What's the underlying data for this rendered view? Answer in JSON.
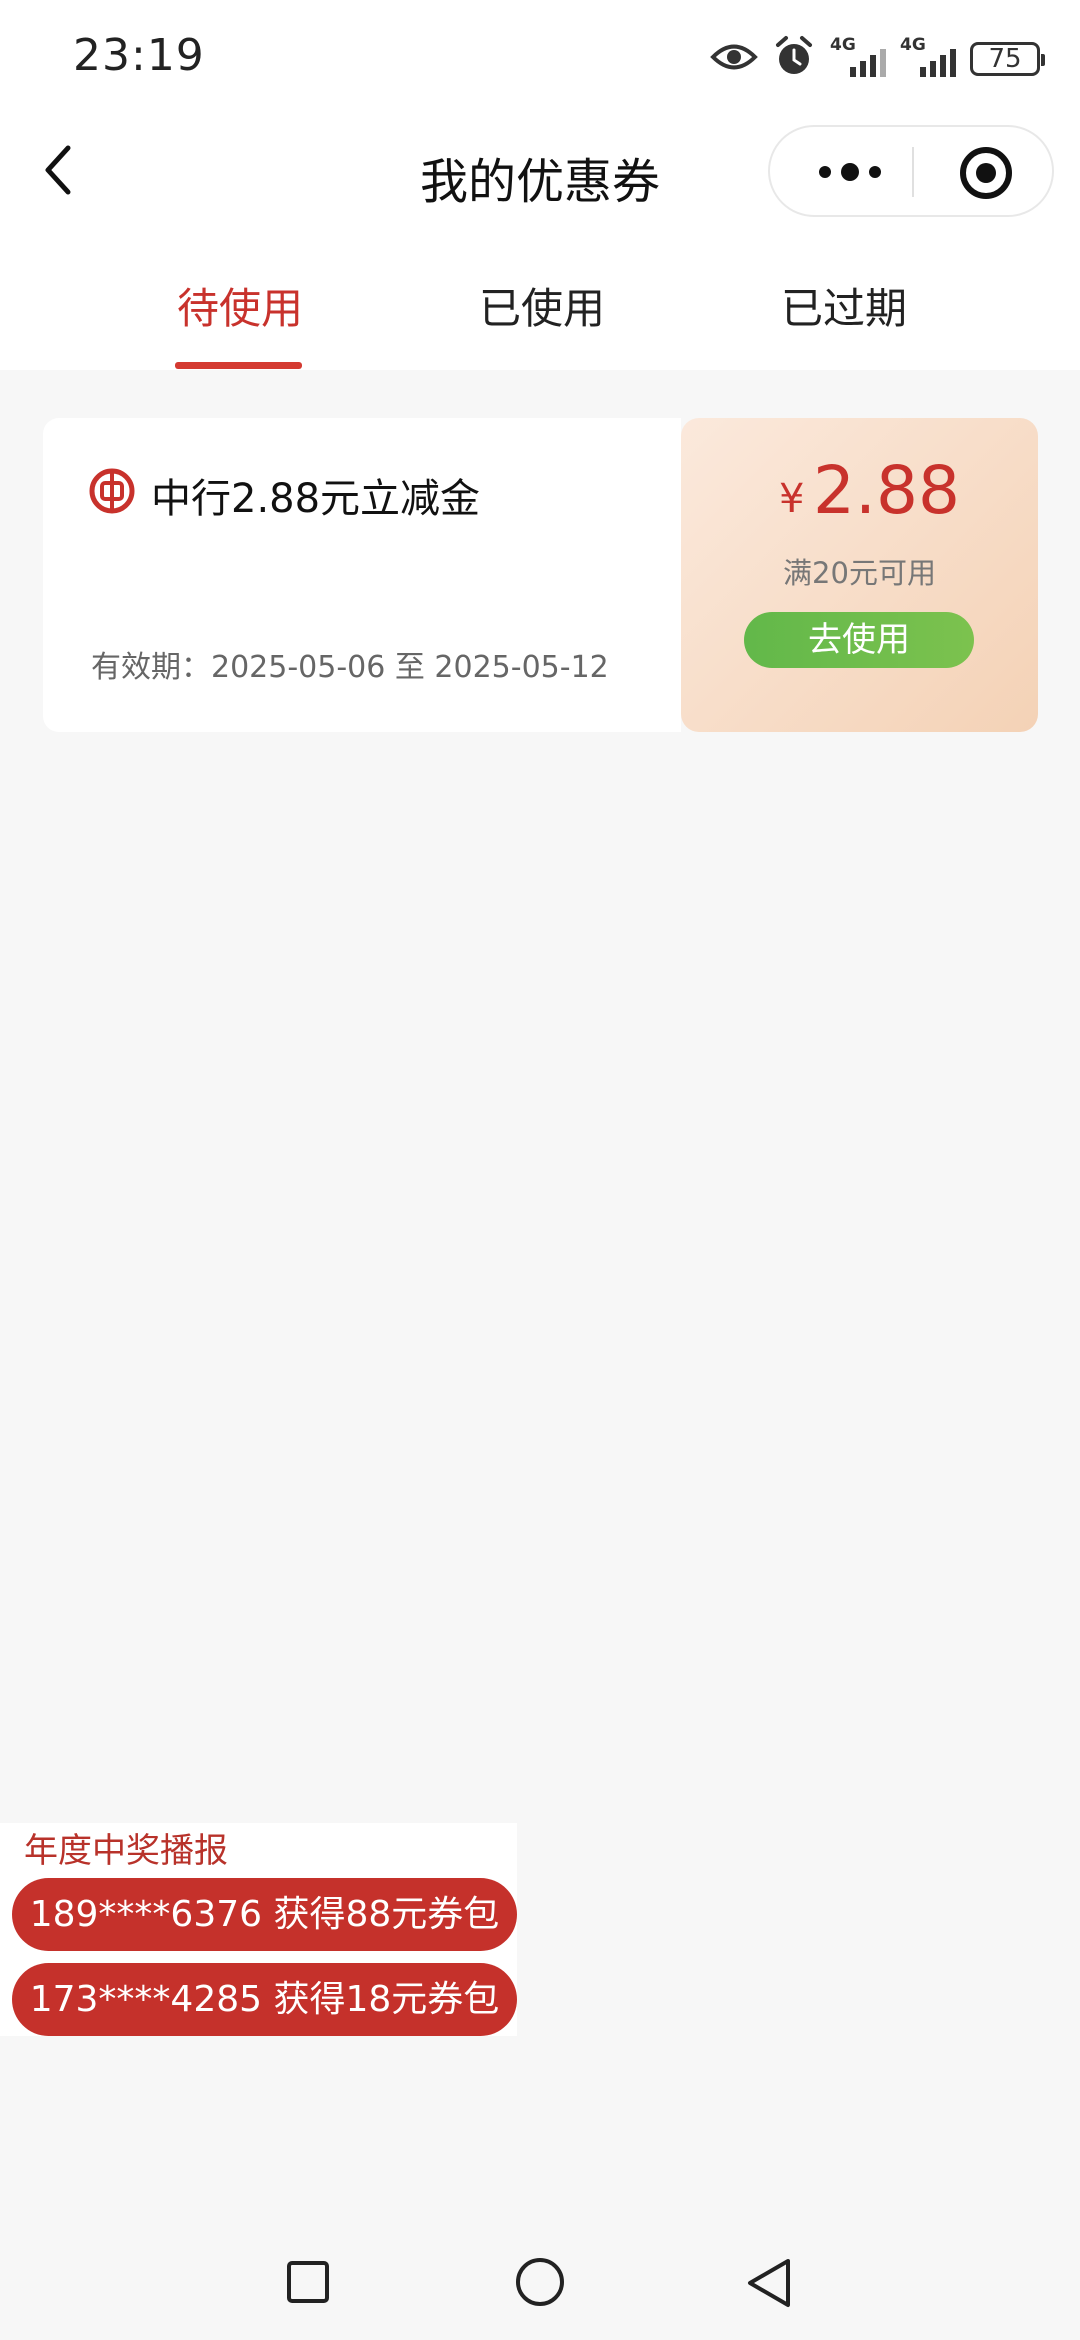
{
  "status_bar": {
    "time": "23:19",
    "icons": [
      "eye-icon",
      "alarm-icon",
      "signal-4g-icon",
      "signal-4g-icon"
    ],
    "sim1_label": "4G",
    "sim2_label": "4G",
    "battery": "75"
  },
  "nav": {
    "title": "我的优惠券",
    "back_icon": "chevron-left-icon",
    "more_icon": "more-dots-icon",
    "close_icon": "target-icon"
  },
  "tabs": [
    {
      "label": "待使用",
      "active": true
    },
    {
      "label": "已使用",
      "active": false
    },
    {
      "label": "已过期",
      "active": false
    }
  ],
  "coupon": {
    "title": "中行2.88元立减金",
    "validity": "有效期：2025-05-06 至 2025-05-12",
    "currency": "¥",
    "amount": "2.88",
    "condition": "满20元可用",
    "button": "去使用",
    "logo_icon": "bank-of-china-logo-icon"
  },
  "broadcast": {
    "title": "年度中奖播报",
    "items": [
      "189****6376 获得88元券包",
      "173****4285 获得18元券包"
    ]
  },
  "colors": {
    "accent": "#c8322c",
    "button_green": "#6bbd4b",
    "coupon_bg": "#f4d2b6",
    "page_bg": "#f7f7f7"
  }
}
